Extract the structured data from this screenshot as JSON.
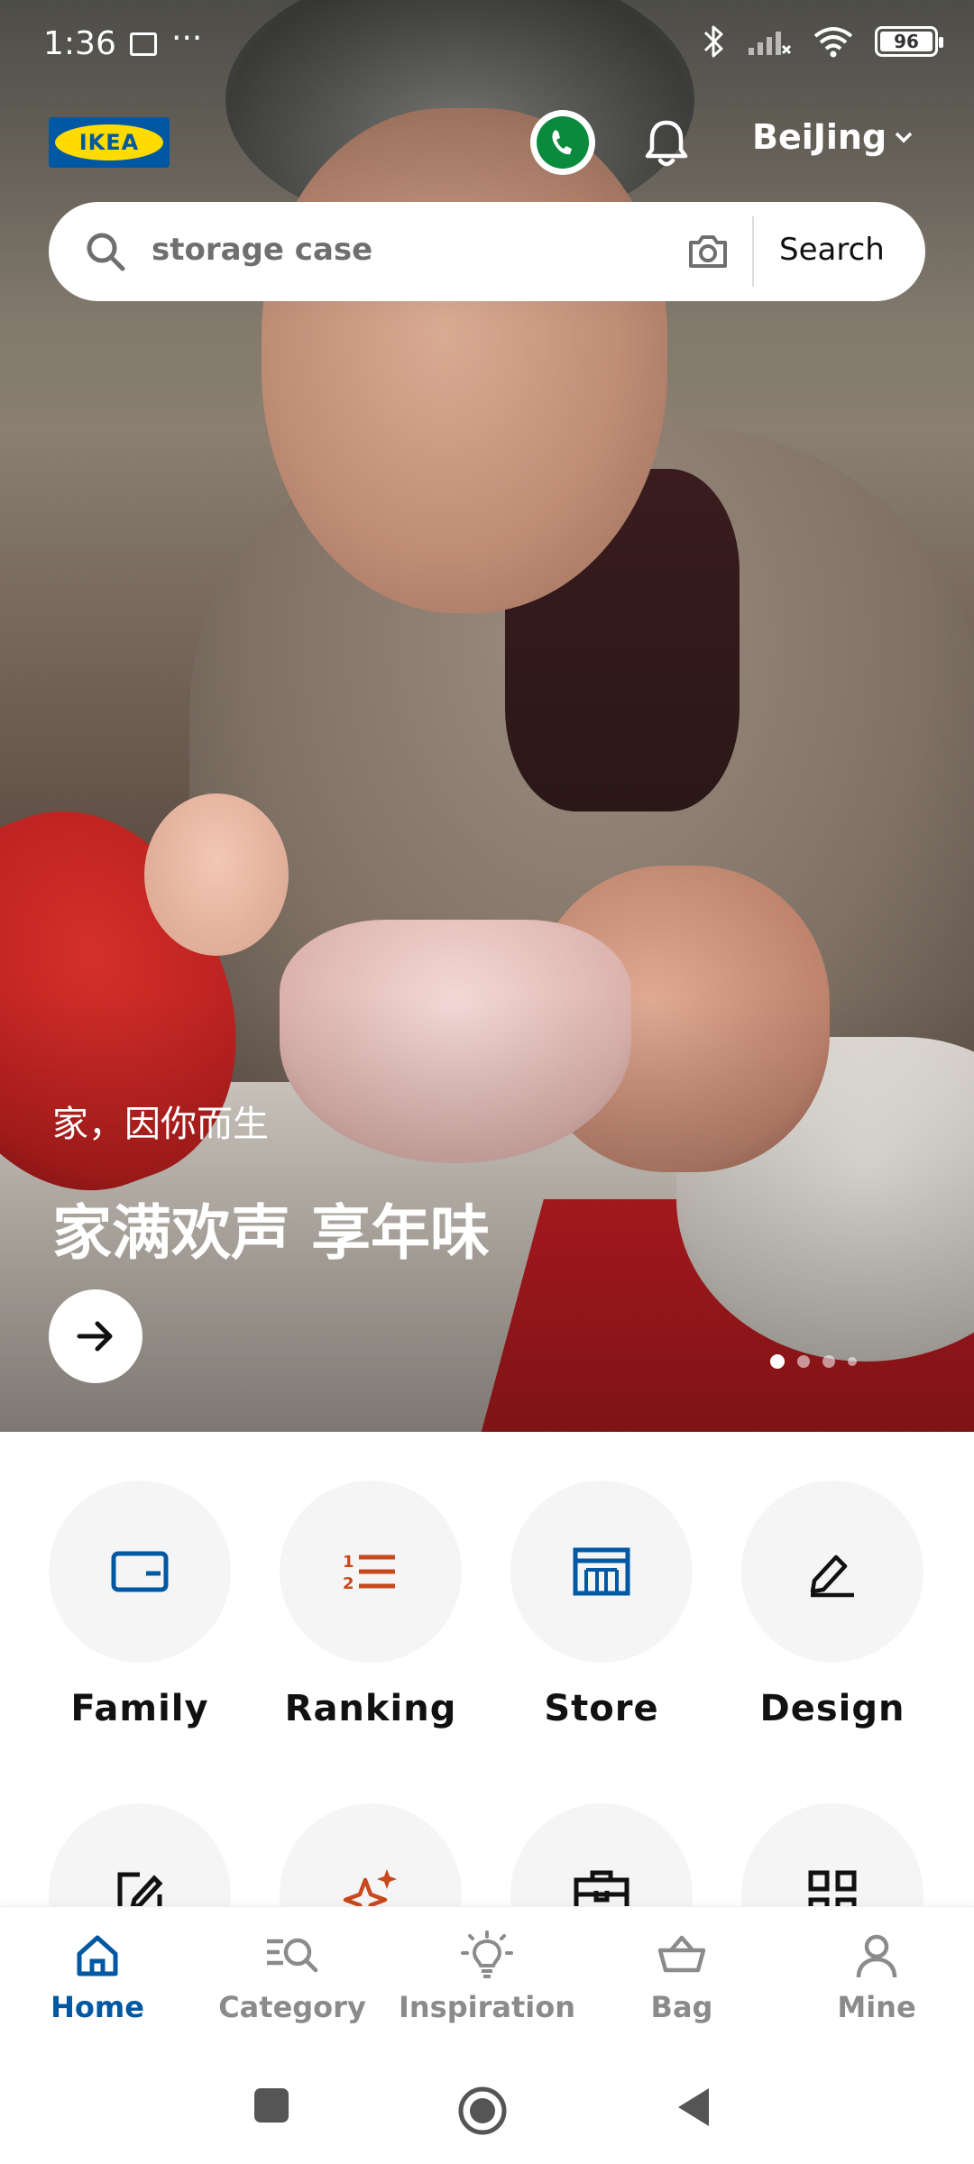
{
  "status_bar": {
    "time": "1:36",
    "more": "···",
    "battery": "96"
  },
  "header": {
    "logo_text": "IKEA",
    "city": "BeiJing"
  },
  "search": {
    "placeholder": "storage case",
    "button_label": "Search"
  },
  "hero": {
    "subtitle": "家，因你而生",
    "title": "家满欢声 享年味",
    "pager_count": 4,
    "pager_active": 0
  },
  "quick_actions": [
    {
      "label": "Family",
      "icon": "card-icon"
    },
    {
      "label": "Ranking",
      "icon": "ranking-list-icon"
    },
    {
      "label": "Store",
      "icon": "store-icon"
    },
    {
      "label": "Design",
      "icon": "pencil-edit-icon"
    }
  ],
  "quick_actions_row2": [
    {
      "icon": "edit-square-icon"
    },
    {
      "icon": "sparkle-icon"
    },
    {
      "icon": "service-bag-icon"
    },
    {
      "icon": "grid-qr-icon"
    }
  ],
  "bottom_nav": [
    {
      "label": "Home",
      "active": true
    },
    {
      "label": "Category",
      "active": false
    },
    {
      "label": "Inspiration",
      "active": false
    },
    {
      "label": "Bag",
      "active": false
    },
    {
      "label": "Mine",
      "active": false
    }
  ],
  "colors": {
    "ikea_blue": "#0058a3",
    "ikea_yellow": "#ffdb00",
    "ranking_orange": "#c8491e",
    "nav_inactive": "#8b8b8b",
    "call_green": "#0a8a3c"
  }
}
